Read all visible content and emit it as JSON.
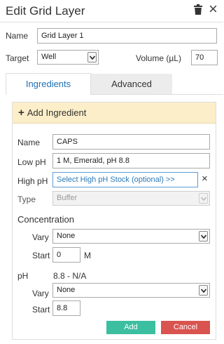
{
  "window": {
    "title": "Edit Grid Layer"
  },
  "layer": {
    "name_label": "Name",
    "name_value": "Grid Layer 1",
    "target_label": "Target",
    "target_value": "Well",
    "volume_label": "Volume (µL)",
    "volume_value": "70"
  },
  "tabs": [
    {
      "label": "Ingredients",
      "active": true
    },
    {
      "label": "Advanced",
      "active": false
    }
  ],
  "ingredient": {
    "header": "Add Ingredient",
    "name_label": "Name",
    "name_value": "CAPS",
    "low_ph_label": "Low pH",
    "low_ph_value": "1 M, Emerald, pH 8.8",
    "high_ph_label": "High pH",
    "high_ph_placeholder": "Select High pH Stock (optional) >>",
    "type_label": "Type",
    "type_value": "Buffer",
    "concentration_title": "Concentration",
    "conc_vary_label": "Vary",
    "conc_vary_value": "None",
    "conc_start_label": "Start",
    "conc_start_value": "0",
    "conc_unit": "M",
    "ph_label": "pH",
    "ph_range": "8.8 - N/A",
    "ph_vary_label": "Vary",
    "ph_vary_value": "None",
    "ph_start_label": "Start",
    "ph_start_value": "8.8",
    "add_button": "Add",
    "cancel_button": "Cancel"
  },
  "icons": {
    "trash": "trash-icon",
    "close": "close-icon",
    "plus": "plus-icon",
    "clear": "clear-icon",
    "dropdown": "chevron-down-icon"
  },
  "colors": {
    "tab_active_text": "#1f6fb5",
    "add_header_bg": "#fbeec8",
    "add_button": "#3bbfa0",
    "cancel_button": "#d9534f",
    "focus_border": "#5b9bd5"
  }
}
